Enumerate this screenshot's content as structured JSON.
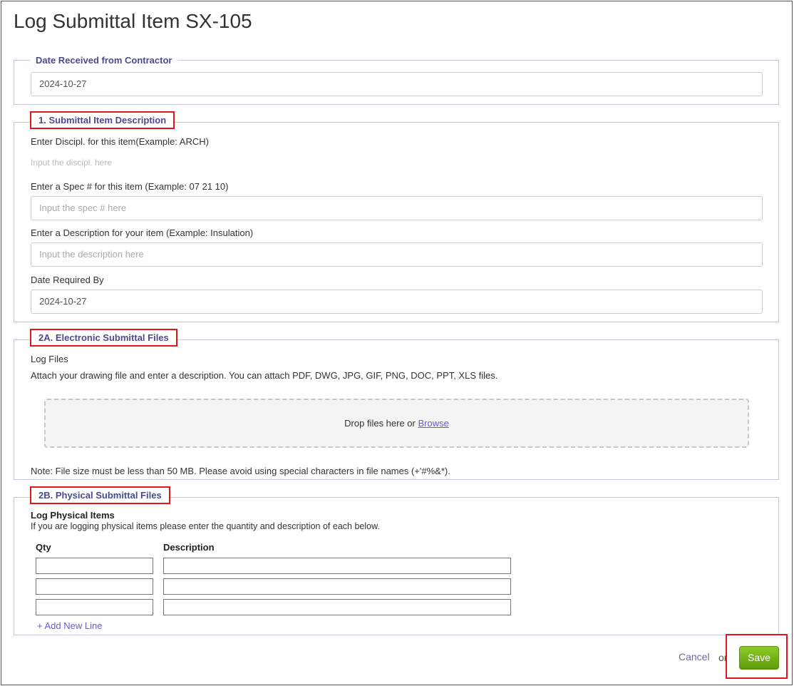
{
  "page": {
    "title": "Log Submittal Item SX-105"
  },
  "date_received": {
    "legend": "Date Received from Contractor",
    "value": "2024-10-27"
  },
  "description_section": {
    "legend": "1. Submittal Item Description",
    "discipline_label": "Enter Discipl. for this item(Example: ARCH)",
    "discipline_placeholder": "Input the discipl. here",
    "spec_label": "Enter a Spec # for this item (Example: 07 21 10)",
    "spec_placeholder": "Input the spec # here",
    "desc_label": "Enter a Description for your item (Example: Insulation)",
    "desc_placeholder": "Input the description here",
    "date_required_label": "Date Required By",
    "date_required_value": "2024-10-27"
  },
  "electronic_files": {
    "legend": "2A. Electronic Submittal Files",
    "log_files_label": "Log Files",
    "instructions": "Attach your drawing file and enter a description. You can attach PDF, DWG, JPG, GIF, PNG, DOC, PPT, XLS files.",
    "drop_text": "Drop files here or ",
    "browse_label": "Browse",
    "note": "Note: File size must be less than 50 MB. Please avoid using special characters in file names (+'#%&*)."
  },
  "physical_files": {
    "legend": "2B. Physical Submittal Files",
    "heading": "Log Physical Items",
    "instructions": "If you are logging physical items please enter the quantity and description of each below.",
    "qty_header": "Qty",
    "description_header": "Description",
    "add_line_label": "+ Add New Line"
  },
  "actions": {
    "cancel_label": "Cancel",
    "or_label": "or",
    "save_label": "Save"
  },
  "colors": {
    "legend_text": "#4a4a8c",
    "highlight": "#e0161c",
    "save_green": "#6aab14",
    "link": "#6a5acd"
  }
}
